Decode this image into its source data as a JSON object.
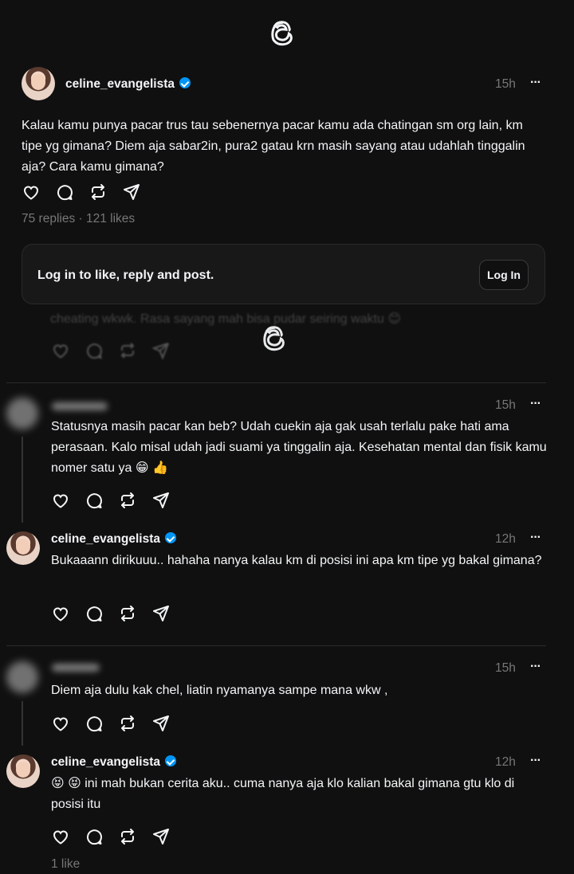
{
  "logo": {
    "icon": "threads-logo-icon"
  },
  "main_post": {
    "username": "celine_evangelista",
    "time": "15h",
    "more": "···",
    "text": "Kalau kamu punya pacar trus tau sebenernya pacar kamu ada chatingan sm org lain, km tipe yg gimana? Diem aja sabar2in, pura2 gatau krn masih sayang atau udahlah tinggalin aja? Cara kamu gimana?",
    "replies": "75 replies",
    "likes": "121 likes",
    "sep": " · "
  },
  "login_prompt": {
    "text": "Log in to like, reply and post.",
    "button": "Log In"
  },
  "ghost_reply": {
    "text": "cheating wkwk. Rasa sayang mah bisa pudar seiring waktu 😊"
  },
  "replies": [
    {
      "time": "15h",
      "more": "···",
      "text": "Statusnya masih pacar kan beb? Udah cuekin aja gak usah terlalu pake hati ama perasaan. Kalo misal udah jadi suami ya tinggalin aja. Kesehatan mental dan fisik kamu nomer satu ya 😁 👍"
    },
    {
      "username": "celine_evangelista",
      "time": "12h",
      "more": "···",
      "text": "Bukaaann dirikuuu.. hahaha nanya kalau km di posisi ini apa km tipe yg bakal gimana?"
    },
    {
      "time": "15h",
      "more": "···",
      "text": "Diem aja dulu kak chel, liatin nyamanya sampe mana wkw ,"
    },
    {
      "username": "celine_evangelista",
      "time": "12h",
      "more": "···",
      "text": "😝 😝 ini mah bukan cerita aku.. cuma nanya aja klo kalian bakal gimana gtu klo di posisi itu",
      "likes": "1 like"
    }
  ],
  "icons": [
    "heart-icon",
    "comment-icon",
    "repost-icon",
    "share-icon"
  ],
  "colors": {
    "background": "#101010",
    "text": "#f3f5f7",
    "muted": "#777777",
    "verified": "#0095f6"
  }
}
